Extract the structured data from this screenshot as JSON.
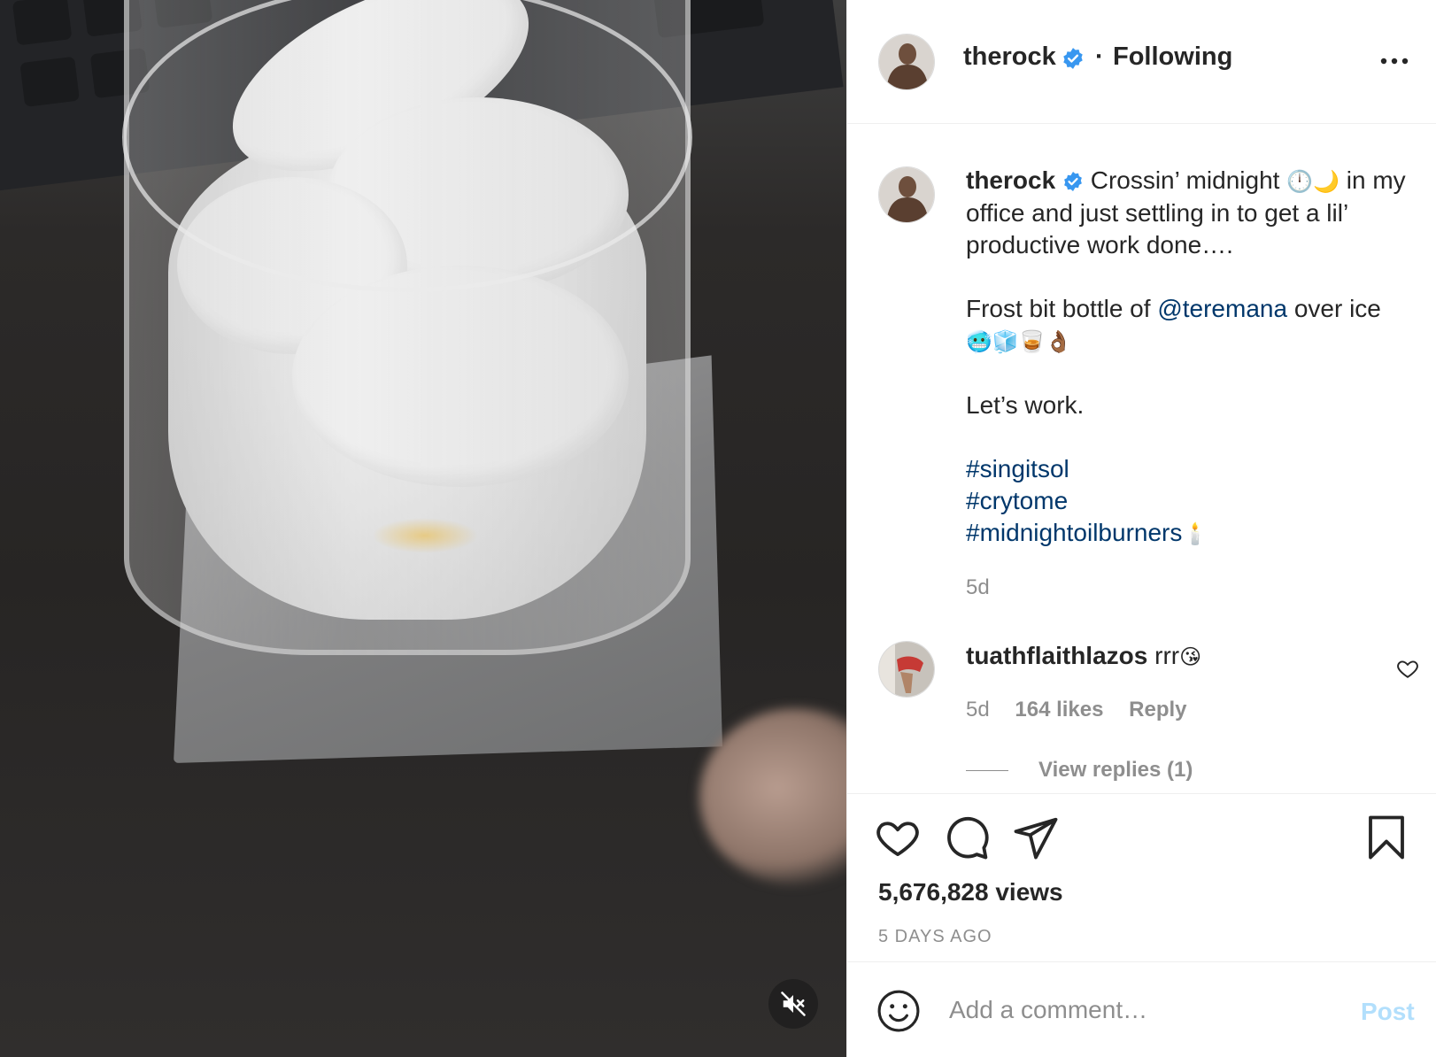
{
  "post": {
    "username": "therock",
    "follow_separator": "·",
    "follow_status": "Following",
    "caption": {
      "username": "therock",
      "line1_text": "Crossin’ midnight",
      "line1_emoji": "🕛🌙",
      "line1_rest": "in my office and just settling in to get a lil’ productive work done….",
      "line2_prefix": "Frost bit bottle of",
      "line2_mention": "@teremana",
      "line2_suffix": "over ice",
      "line2_emoji": "🥶🧊🥃👌🏾",
      "line3": "Let’s work.",
      "hashtags": [
        "#singitsol",
        "#crytome",
        "#midnightoilburners"
      ],
      "hashtag_emoji": "🕯️",
      "time": "5d"
    },
    "comment": {
      "username": "tuathflaithlazos",
      "text": "rrr",
      "emoji": "😘",
      "time": "5d",
      "likes": "164 likes",
      "reply_label": "Reply",
      "view_replies": "View replies (1)"
    },
    "views": "5,676,828 views",
    "posted_ago": "5 DAYS AGO",
    "add_comment": {
      "placeholder": "Add a comment…",
      "post_label": "Post"
    }
  },
  "icons": {
    "verified": "verified-badge-icon",
    "more": "more-options-icon",
    "like": "heart-icon",
    "comment": "comment-bubble-icon",
    "share": "paper-plane-icon",
    "save": "bookmark-icon",
    "emoji": "smiley-icon",
    "mute": "muted-speaker-icon"
  },
  "colors": {
    "verified_blue": "#3897f0",
    "link_blue": "#00376b",
    "secondary_text": "#8e8e8e",
    "post_button_disabled": "#b2dffc"
  }
}
